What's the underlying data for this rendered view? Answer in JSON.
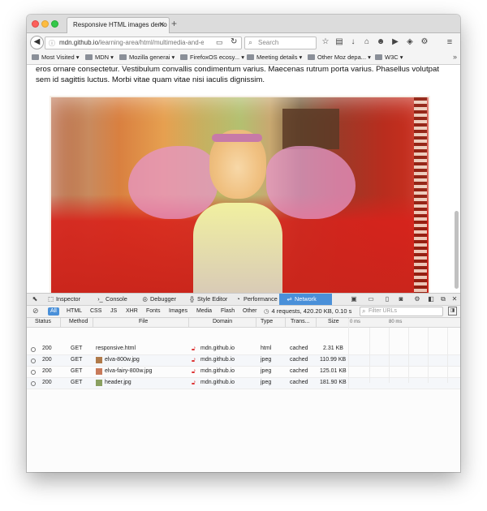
{
  "window": {
    "tab_title": "Responsive HTML images demo",
    "tab_close": "✕",
    "new_tab": "+"
  },
  "navbar": {
    "back": "◀",
    "info": "ⓘ",
    "url_host": "mdn.github.io",
    "url_path": "/learning-area/html/multimedia-and-em",
    "reader": "▭",
    "reload": "↻",
    "search_placeholder": "Search",
    "icons": [
      "bookmark-star-icon",
      "reading-list-icon",
      "download-icon",
      "home-icon",
      "chat-icon",
      "youtube-icon",
      "pocket-icon",
      "extension-icon",
      "menu-icon"
    ]
  },
  "bookmarks": {
    "items": [
      "Most Visited ▾",
      "MDN ▾",
      "Mozilla generai ▾",
      "FirefoxOS ecosy... ▾",
      "Meeting details ▾",
      "Other Moz depa... ▾",
      "W3C ▾"
    ],
    "more": "»"
  },
  "page": {
    "paragraph": "eros ornare consectetur. Vestibulum convallis condimentum varius. Maecenas rutrum porta varius. Phasellus volutpat sem id sagittis luctus. Morbi vitae quam vitae nisi iaculis dignissim."
  },
  "devtools": {
    "tabs": [
      "Inspector",
      "Console",
      "Debugger",
      "Style Editor",
      "Performance",
      "Network"
    ],
    "active_tab": "Network",
    "filters": [
      "All",
      "HTML",
      "CSS",
      "JS",
      "XHR",
      "Fonts",
      "Images",
      "Media",
      "Flash",
      "Other"
    ],
    "active_filter": "All",
    "summary": "4 requests, 420.20 KB, 0.10 s",
    "filter_placeholder": "Filter URLs",
    "columns": [
      "Status",
      "Method",
      "File",
      "Domain",
      "Type",
      "Trans...",
      "Size"
    ],
    "timeline_ticks": [
      "0 ms",
      "80 ms"
    ],
    "rows": [
      {
        "status": "200",
        "method": "GET",
        "file": "responsive.html",
        "domain": "mdn.github.io",
        "type": "html",
        "transferred": "cached",
        "size": "2.31 KB"
      },
      {
        "status": "200",
        "method": "GET",
        "file": "elva-800w.jpg",
        "domain": "mdn.github.io",
        "type": "jpeg",
        "transferred": "cached",
        "size": "110.99 KB"
      },
      {
        "status": "200",
        "method": "GET",
        "file": "elva-fairy-800w.jpg",
        "domain": "mdn.github.io",
        "type": "jpeg",
        "transferred": "cached",
        "size": "125.01 KB"
      },
      {
        "status": "200",
        "method": "GET",
        "file": "header.jpg",
        "domain": "mdn.github.io",
        "type": "jpeg",
        "transferred": "cached",
        "size": "181.90 KB"
      }
    ]
  }
}
